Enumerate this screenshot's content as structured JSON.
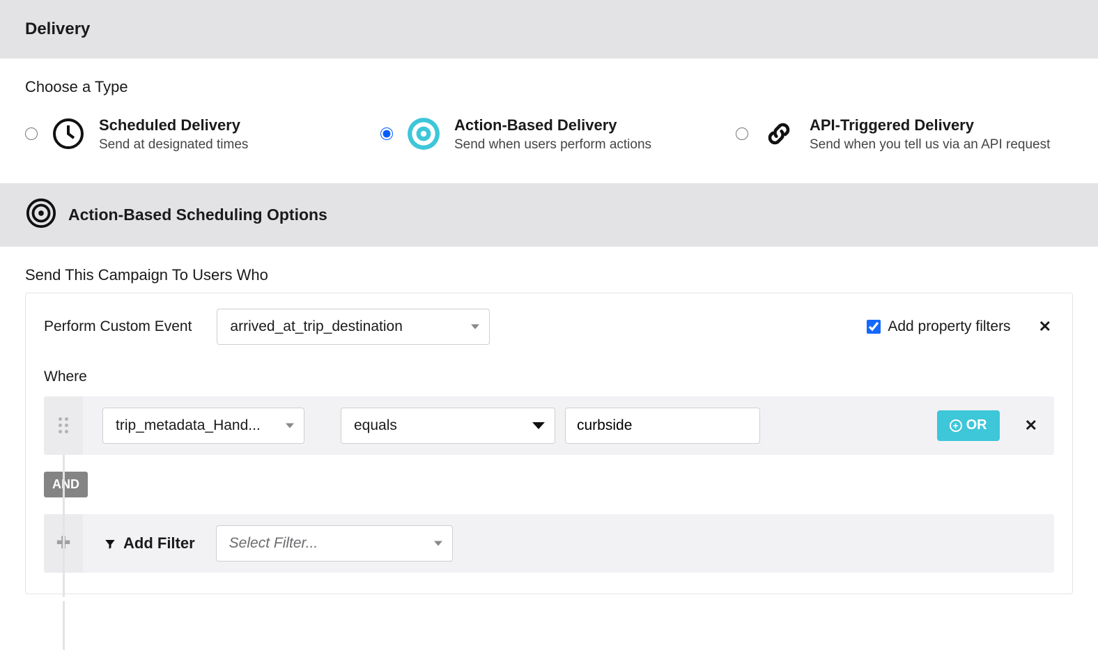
{
  "header": {
    "title": "Delivery"
  },
  "typeSection": {
    "label": "Choose a Type",
    "options": {
      "scheduled": {
        "title": "Scheduled Delivery",
        "sub": "Send at designated times"
      },
      "action": {
        "title": "Action-Based Delivery",
        "sub": "Send when users perform actions"
      },
      "api": {
        "title": "API-Triggered Delivery",
        "sub": "Send when you tell us via an API request"
      }
    }
  },
  "actionSection": {
    "title": "Action-Based Scheduling Options",
    "sendTo": "Send This Campaign To Users Who",
    "performLabel": "Perform Custom Event",
    "eventValue": "arrived_at_trip_destination",
    "addPropFilters": "Add property filters",
    "where": "Where",
    "filter1": {
      "property": "trip_metadata_Hand...",
      "operator": "equals",
      "value": "curbside"
    },
    "orLabel": "OR",
    "andLabel": "AND",
    "addFilterLabel": "Add Filter",
    "selectFilterPlaceholder": "Select Filter..."
  }
}
